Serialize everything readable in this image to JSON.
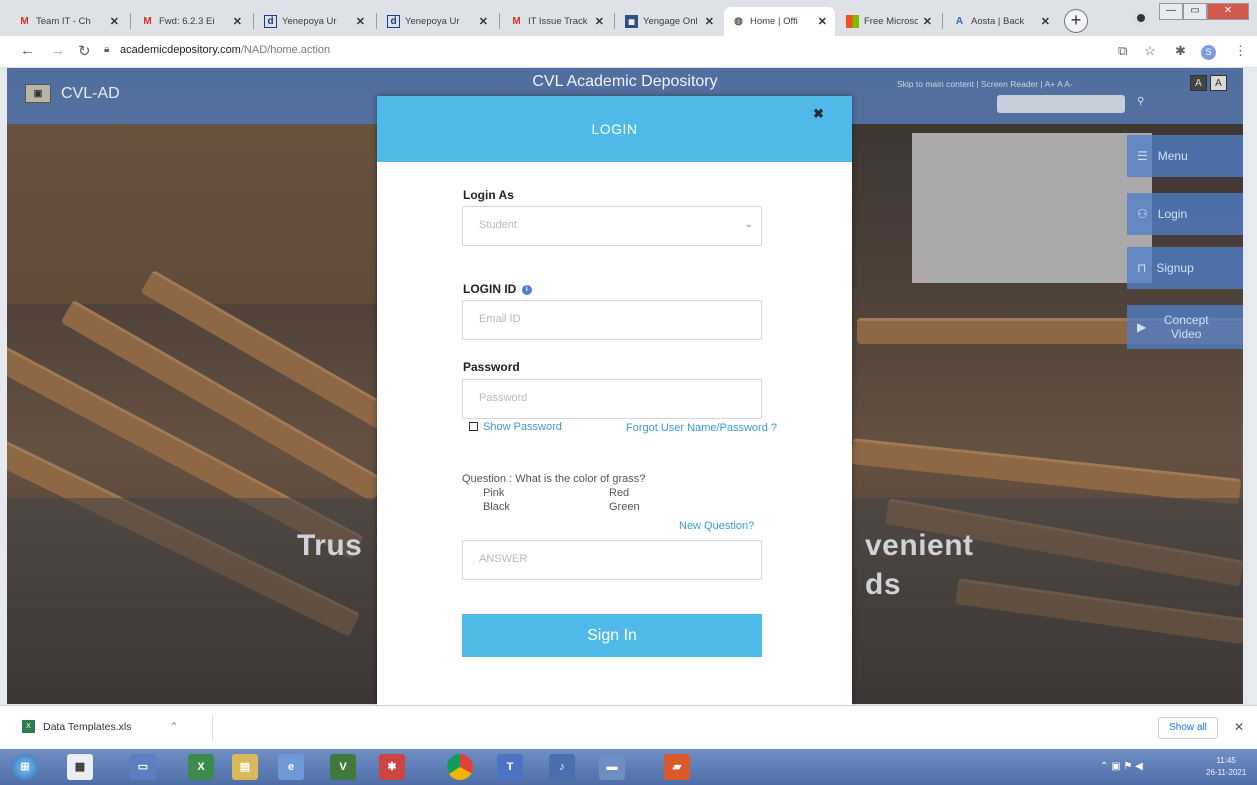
{
  "browser": {
    "tabs": [
      {
        "title": "Team IT - Ch",
        "favicon": "gmail-icon"
      },
      {
        "title": "Fwd: 6.2.3 Ei",
        "favicon": "gmail-icon"
      },
      {
        "title": "Yenepoya Ur",
        "favicon": "d-icon"
      },
      {
        "title": "Yenepoya Ur",
        "favicon": "d-icon"
      },
      {
        "title": "IT Issue Track",
        "favicon": "gmail-icon"
      },
      {
        "title": "Yengage Onl",
        "favicon": "yengage-icon"
      },
      {
        "title": "Home | Offi",
        "favicon": "globe-icon"
      },
      {
        "title": "Free Microso",
        "favicon": "microsoft-icon"
      },
      {
        "title": "Aosta | Back",
        "favicon": "aosta-icon"
      }
    ],
    "url": {
      "domain": "academicdepository.com",
      "path": "/NAD/home.action"
    },
    "profile_initial": "S"
  },
  "site": {
    "logo_text": "CVL-AD",
    "title": "CVL Academic Depository",
    "skip_link": "Skip to main content | Screen Reader | A+ A A-",
    "contrast_dark": "A",
    "contrast_light": "A",
    "side_menu": [
      {
        "label": "Menu",
        "icon": "hamburger-icon"
      },
      {
        "label": "Login",
        "icon": "user-icon"
      },
      {
        "label": "Signup",
        "icon": "lock-icon"
      },
      {
        "label": "Concept Video",
        "icon": "play-icon"
      }
    ],
    "hero_left": "Trus",
    "hero_right_1": "venient",
    "hero_right_2": "ds"
  },
  "login": {
    "title": "LOGIN",
    "login_as_label": "Login As",
    "login_as_value": "Student",
    "login_id_label": "LOGIN ID",
    "login_id_placeholder": "Email ID",
    "password_label": "Password",
    "password_placeholder": "Password",
    "show_password": "Show Password",
    "forgot_link": "Forgot User Name/Password ?",
    "question": "Question : What is the color of grass?",
    "options": [
      "Pink",
      "Red",
      "Black",
      "Green"
    ],
    "new_question": "New Question?",
    "answer_placeholder": "ANSWER",
    "sign_in": "Sign In"
  },
  "downloads": {
    "file": "Data Templates.xls",
    "show_all": "Show all"
  },
  "taskbar": {
    "time": "11:45",
    "date": "26-11-2021"
  }
}
